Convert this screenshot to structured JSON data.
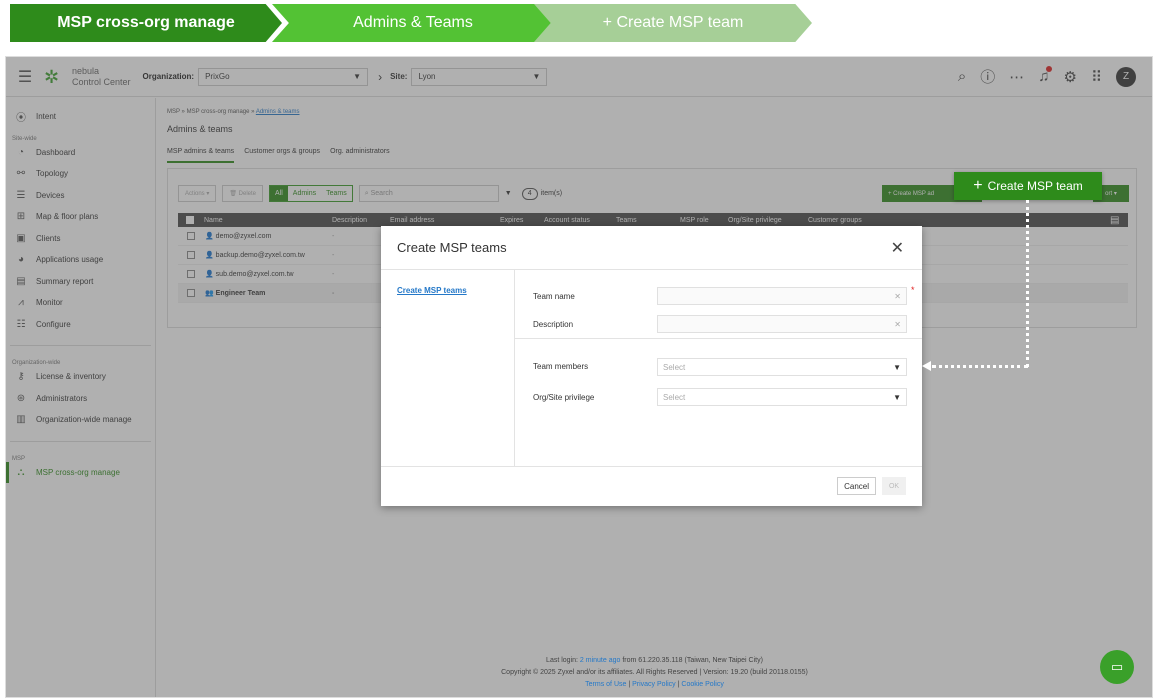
{
  "crumbs": [
    "MSP cross-org manage",
    "Admins & Teams",
    "+ Create MSP team"
  ],
  "topbar": {
    "logo_line1": "nebula",
    "logo_line2": "Control Center",
    "org_label": "Organization:",
    "org_value": "PrixGo",
    "site_label": "Site:",
    "site_value": "Lyon",
    "avatar": "Z"
  },
  "sidebar": {
    "intent": "Intent",
    "site_wide": "Site-wide",
    "site_items": [
      "Dashboard",
      "Topology",
      "Devices",
      "Map & floor plans",
      "Clients",
      "Applications usage",
      "Summary report",
      "Monitor",
      "Configure"
    ],
    "org_wide": "Organization-wide",
    "org_items": [
      "License & inventory",
      "Administrators",
      "Organization-wide manage"
    ],
    "msp": "MSP",
    "msp_item": "MSP cross-org manage"
  },
  "main": {
    "breadcrumb_prefix": "MSP » MSP cross-org manage »",
    "breadcrumb_link": "Admins & teams",
    "title": "Admins & teams",
    "tabs": [
      "MSP admins & teams",
      "Customer orgs & groups",
      "Org. administrators"
    ],
    "actions_btn": "Actions ▾",
    "delete_btn": "Delete",
    "filter": [
      "All",
      "Admins",
      "Teams"
    ],
    "search_placeholder": "Search",
    "count": "4",
    "count_label": "item(s)",
    "create_btn": "+ Create MSP ad",
    "export_btn": "ort ▾",
    "columns": [
      "Name",
      "Description",
      "Email address",
      "Expires",
      "Account status",
      "Teams",
      "MSP role",
      "Org/Site privilege",
      "Customer groups"
    ],
    "rows": [
      {
        "name": "demo@zyxel.com",
        "desc": "-"
      },
      {
        "name": "backup.demo@zyxel.com.tw",
        "desc": "-"
      },
      {
        "name": "sub.demo@zyxel.com.tw",
        "desc": "-"
      },
      {
        "name": "Engineer Team",
        "desc": "-"
      }
    ]
  },
  "modal": {
    "title": "Create MSP teams",
    "left_link": "Create MSP teams",
    "team_name_label": "Team name",
    "description_label": "Description",
    "team_members_label": "Team members",
    "org_site_label": "Org/Site privilege",
    "select_placeholder": "Select",
    "cancel": "Cancel",
    "ok": "OK"
  },
  "callout": {
    "label": "Create MSP team"
  },
  "footer": {
    "last_login_prefix": "Last login:",
    "last_login_link": "2 minute ago",
    "last_login_suffix": "from 61.220.35.118 (Taiwan, New Taipei City)",
    "copyright": "Copyright © 2025 Zyxel and/or its affiliates. All Rights Reserved | Version: 19.20 (build 20118.0155)",
    "links": [
      "Terms of Use",
      "Privacy Policy",
      "Cookie Policy"
    ]
  },
  "colors": {
    "brand_dark": "#2e8b1b",
    "brand_mid": "#53c234",
    "brand_light": "#a6cf97",
    "link": "#2478c8"
  }
}
